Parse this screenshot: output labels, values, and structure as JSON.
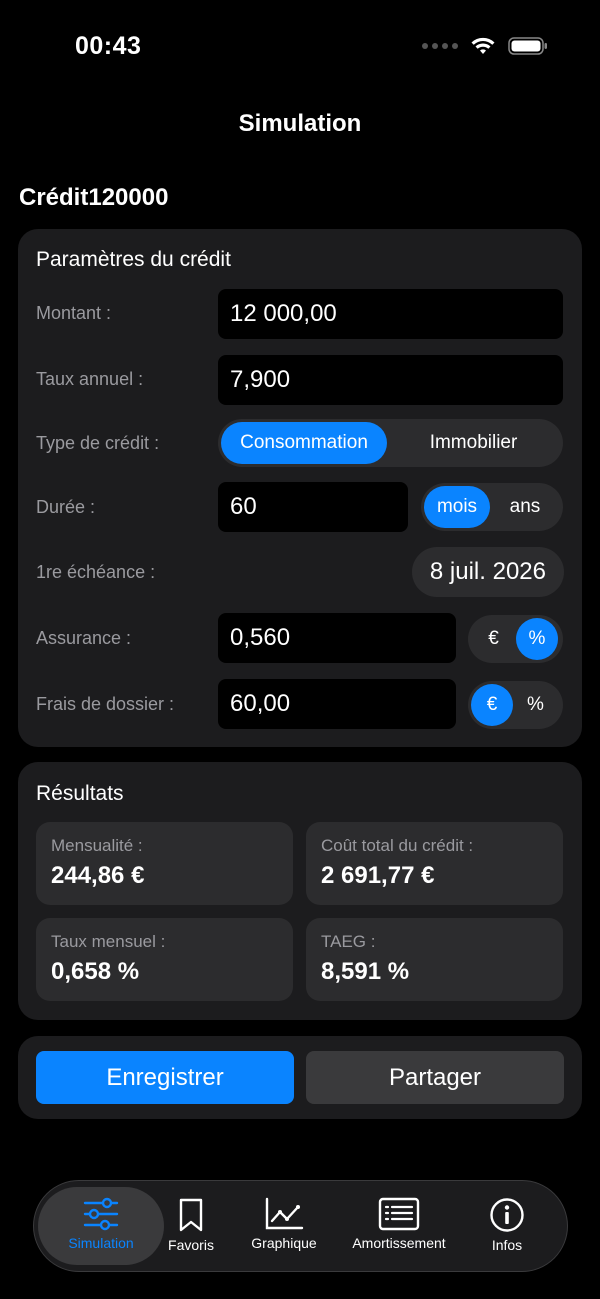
{
  "status": {
    "time": "00:43"
  },
  "nav": {
    "title": "Simulation"
  },
  "simulation_name": "Crédit120000",
  "params": {
    "title": "Paramètres du crédit",
    "amount_label": "Montant :",
    "amount_value": "12 000,00",
    "rate_label": "Taux annuel :",
    "rate_value": "7,900",
    "type_label": "Type de crédit :",
    "type_options": [
      "Consommation",
      "Immobilier"
    ],
    "type_selected": "Consommation",
    "duration_label": "Durée :",
    "duration_value": "60",
    "duration_units": [
      "mois",
      "ans"
    ],
    "duration_unit_selected": "mois",
    "first_payment_label": "1re échéance :",
    "first_payment_value": "8 juil. 2026",
    "insurance_label": "Assurance :",
    "insurance_value": "0,560",
    "insurance_units": [
      "€",
      "%"
    ],
    "insurance_unit_selected": "%",
    "fees_label": "Frais de dossier :",
    "fees_value": "60,00",
    "fees_units": [
      "€",
      "%"
    ],
    "fees_unit_selected": "€"
  },
  "results": {
    "title": "Résultats",
    "monthly_label": "Mensualité :",
    "monthly_value": "244,86 €",
    "total_cost_label": "Coût total du crédit :",
    "total_cost_value": "2 691,77 €",
    "monthly_rate_label": "Taux mensuel :",
    "monthly_rate_value": "0,658 %",
    "taeg_label": "TAEG :",
    "taeg_value": "8,591 %"
  },
  "actions": {
    "save_label": "Enregistrer",
    "share_label": "Partager"
  },
  "tabs": [
    {
      "label": "Simulation",
      "icon": "sliders-icon",
      "active": true
    },
    {
      "label": "Favoris",
      "icon": "bookmark-icon",
      "active": false
    },
    {
      "label": "Graphique",
      "icon": "line-chart-icon",
      "active": false
    },
    {
      "label": "Amortissement",
      "icon": "list-document-icon",
      "active": false
    },
    {
      "label": "Infos",
      "icon": "info-icon",
      "active": false
    }
  ],
  "colors": {
    "accent": "#0a84ff",
    "card": "#1c1c1e",
    "control": "#2c2c2e",
    "background": "#000000"
  }
}
